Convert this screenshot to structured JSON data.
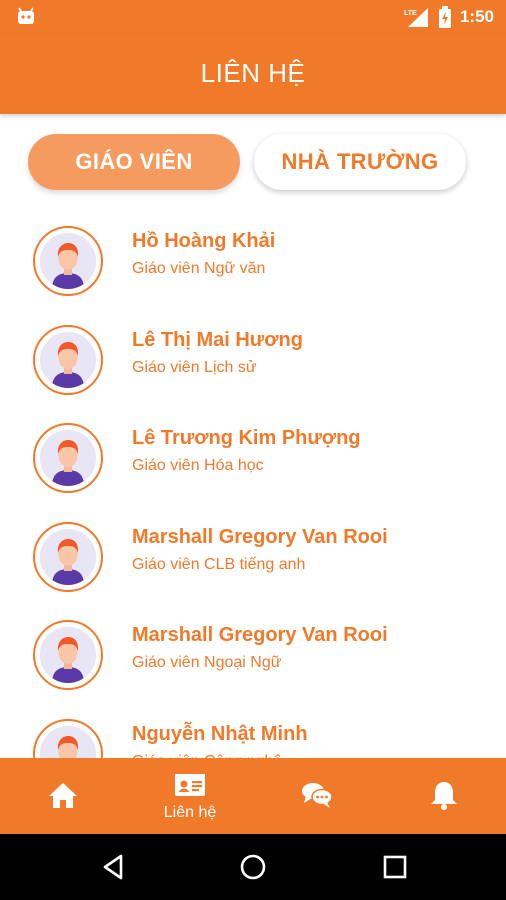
{
  "status_bar": {
    "time": "1:50",
    "network": "LTE"
  },
  "app_bar": {
    "title": "LIÊN HỆ"
  },
  "segment": {
    "teachers_label": "GIÁO VIÊN",
    "school_label": "NHÀ TRƯỜNG",
    "selected": "teachers"
  },
  "contacts": [
    {
      "name": "Hồ Hoàng Khải",
      "role": "Giáo viên Ngữ văn"
    },
    {
      "name": "Lê Thị Mai Hương",
      "role": "Giáo viên Lịch sử"
    },
    {
      "name": "Lê Trương Kim Phượng",
      "role": "Giáo viên Hóa học"
    },
    {
      "name": "Marshall Gregory Van Rooi",
      "role": "Giáo viên CLB tiếng anh"
    },
    {
      "name": "Marshall Gregory Van Rooi",
      "role": "Giáo viên Ngoại Ngữ"
    },
    {
      "name": "Nguyễn Nhật Minh",
      "role": "Giáo viên Công nghệ"
    }
  ],
  "bottom_nav": {
    "items": [
      {
        "icon": "home-icon",
        "label": ""
      },
      {
        "icon": "contact-card-icon",
        "label": "Liên hệ"
      },
      {
        "icon": "chat-icon",
        "label": ""
      },
      {
        "icon": "bell-icon",
        "label": ""
      }
    ],
    "active": 1
  },
  "colors": {
    "primary": "#f07a2a",
    "primary_light": "#f59b60",
    "white": "#ffffff",
    "avatar_bg": "#e8e6f4"
  }
}
